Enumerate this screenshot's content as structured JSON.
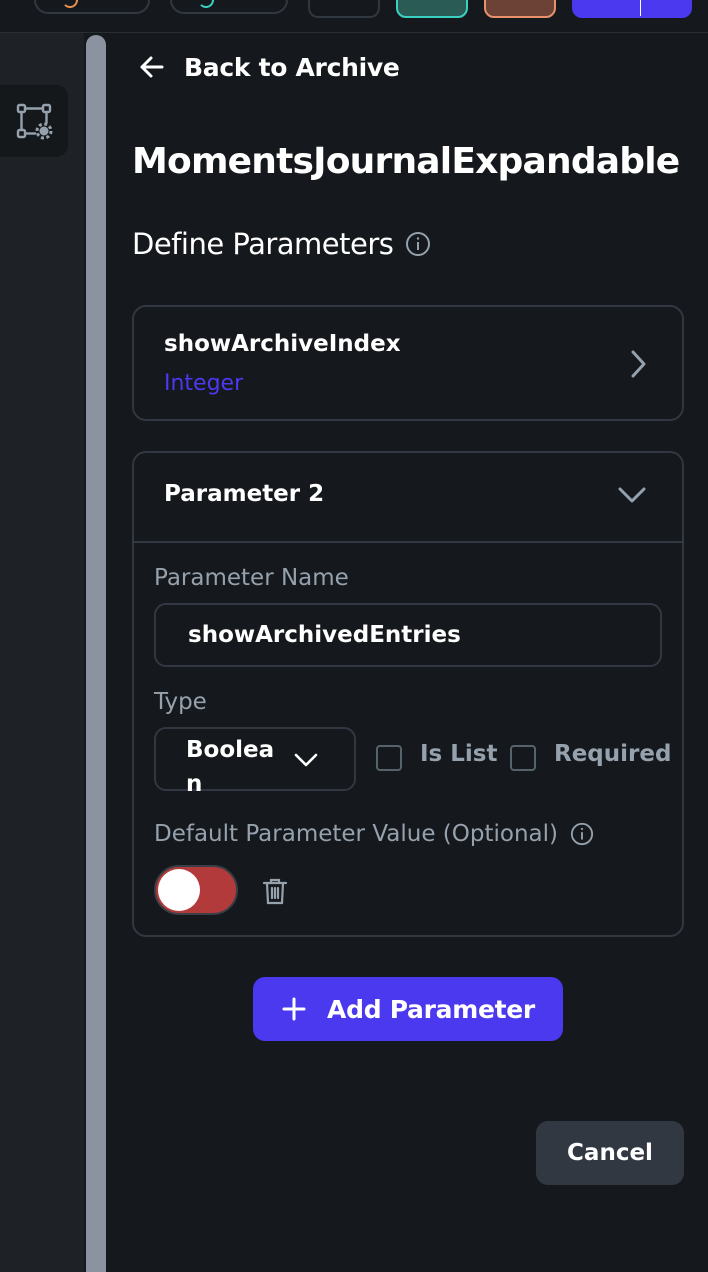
{
  "header": {
    "back_label": "Back to Archive",
    "component_title": "MomentsJournalExpandable",
    "section_title": "Define Parameters"
  },
  "parameters": [
    {
      "name": "showArchiveIndex",
      "type": "Integer",
      "expanded": false
    },
    {
      "header_label": "Parameter 2",
      "expanded": true,
      "name_label": "Parameter Name",
      "name_value": "showArchivedEntries",
      "type_label": "Type",
      "type_value": "Boolean",
      "is_list_label": "Is List",
      "is_list_checked": false,
      "required_label": "Required",
      "required_checked": false,
      "default_label": "Default Parameter Value (Optional)",
      "default_value": false
    }
  ],
  "actions": {
    "add_label": "Add Parameter",
    "cancel_label": "Cancel"
  },
  "colors": {
    "primary": "#4b39ef",
    "background": "#15181c",
    "border": "#323842",
    "secondary_text": "#95a1ac",
    "toggle_off": "#b33a3a"
  },
  "icons": {
    "rail": "flow-settings-icon",
    "back": "arrow-left-icon",
    "info": "info-icon",
    "chevron_right": "chevron-right-icon",
    "chevron_down": "chevron-down-icon",
    "trash": "trash-icon",
    "plus": "plus-icon"
  }
}
